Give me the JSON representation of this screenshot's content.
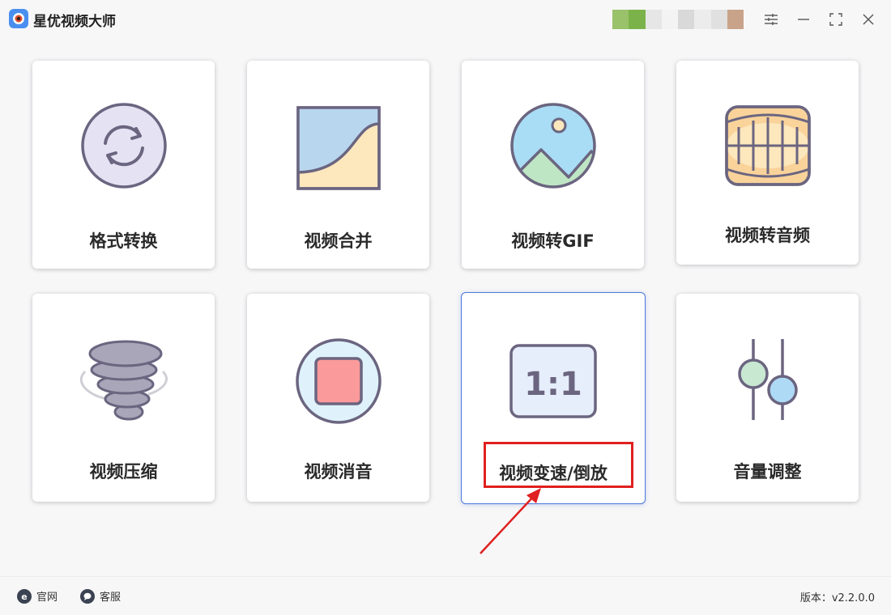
{
  "app": {
    "title": "星优视频大师"
  },
  "titlebar": {
    "user_avatar_colors": [
      "#9ac26a",
      "#7bb34a",
      "#e6e6e6",
      "#f3f3f3",
      "#d9d9d9",
      "#ececec",
      "#e0e0e0",
      "#c8a38a"
    ],
    "buttons": [
      "settings-icon",
      "minimize-icon",
      "maximize-icon",
      "close-icon"
    ]
  },
  "tiles": [
    {
      "label": "格式转换",
      "icon": "convert-icon"
    },
    {
      "label": "视频合并",
      "icon": "merge-icon"
    },
    {
      "label": "视频转GIF",
      "icon": "gif-icon"
    },
    {
      "label": "视频转音频",
      "icon": "audio-icon"
    },
    {
      "label": "视频压缩",
      "icon": "compress-icon"
    },
    {
      "label": "视频消音",
      "icon": "mute-icon"
    },
    {
      "label": "视频变速/倒放",
      "icon": "speed-icon",
      "icon_text": "1:1",
      "selected": true
    },
    {
      "label": "音量调整",
      "icon": "volume-icon"
    }
  ],
  "footer": {
    "website_label": "官网",
    "support_label": "客服",
    "version_text": "版本：v2.2.0.0"
  },
  "colors": {
    "accent": "#4a78d8",
    "annotation_red": "#e02020",
    "icon_stroke": "#6b6580"
  }
}
